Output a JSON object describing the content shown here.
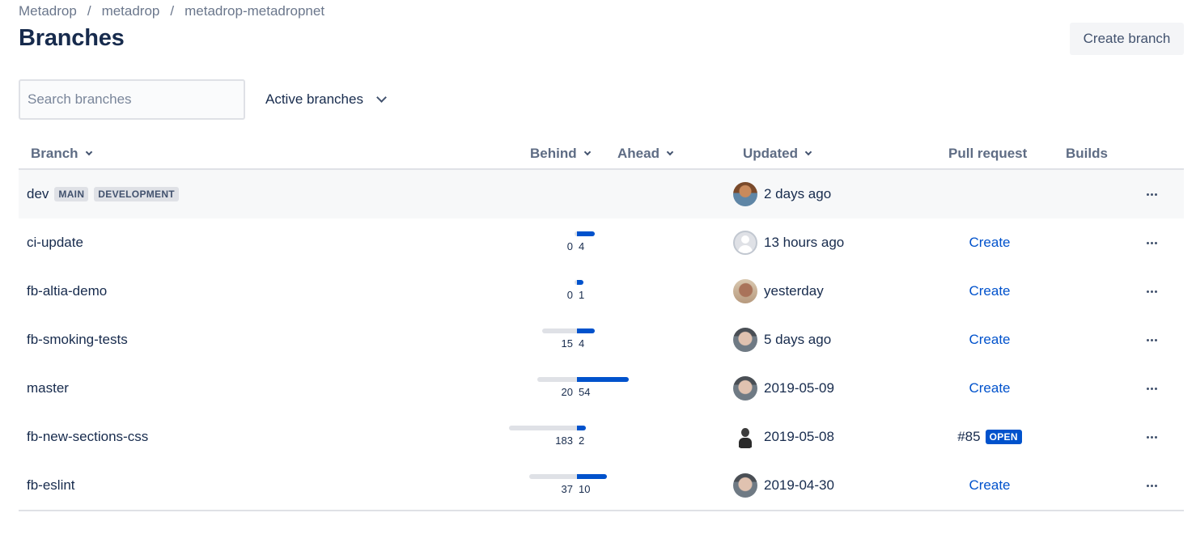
{
  "breadcrumb": [
    "Metadrop",
    "metadrop",
    "metadrop-metadropnet"
  ],
  "page_title": "Branches",
  "create_branch_label": "Create branch",
  "search": {
    "placeholder": "Search branches",
    "value": ""
  },
  "filter": {
    "selected": "Active branches"
  },
  "columns": {
    "branch": "Branch",
    "behind": "Behind",
    "ahead": "Ahead",
    "updated": "Updated",
    "pull_request": "Pull request",
    "builds": "Builds"
  },
  "rows": [
    {
      "name": "dev",
      "lozenges": [
        "MAIN",
        "DEVELOPMENT"
      ],
      "behind": null,
      "ahead": null,
      "updated": "2 days ago",
      "avatar": "user-avatar",
      "pull_request": null,
      "pr_state": null
    },
    {
      "name": "ci-update",
      "lozenges": [],
      "behind": "0",
      "ahead": "4",
      "updated": "13 hours ago",
      "avatar": "default-avatar-icon",
      "pull_request": "Create",
      "pr_state": null
    },
    {
      "name": "fb-altia-demo",
      "lozenges": [],
      "behind": "0",
      "ahead": "1",
      "updated": "yesterday",
      "avatar": "user-avatar",
      "pull_request": "Create",
      "pr_state": null
    },
    {
      "name": "fb-smoking-tests",
      "lozenges": [],
      "behind": "15",
      "ahead": "4",
      "updated": "5 days ago",
      "avatar": "user-avatar",
      "pull_request": "Create",
      "pr_state": null
    },
    {
      "name": "master",
      "lozenges": [],
      "behind": "20",
      "ahead": "54",
      "updated": "2019-05-09",
      "avatar": "user-avatar",
      "pull_request": "Create",
      "pr_state": null
    },
    {
      "name": "fb-new-sections-css",
      "lozenges": [],
      "behind": "183",
      "ahead": "2",
      "updated": "2019-05-08",
      "avatar": "user-avatar",
      "pull_request": "#85",
      "pr_state": "OPEN"
    },
    {
      "name": "fb-eslint",
      "lozenges": [],
      "behind": "37",
      "ahead": "10",
      "updated": "2019-04-30",
      "avatar": "user-avatar",
      "pull_request": "Create",
      "pr_state": null
    }
  ],
  "colors": {
    "accent": "#0052cc",
    "behind_bar": "#dfe1e6",
    "text": "#172b4d",
    "muted": "#5e6c84"
  }
}
